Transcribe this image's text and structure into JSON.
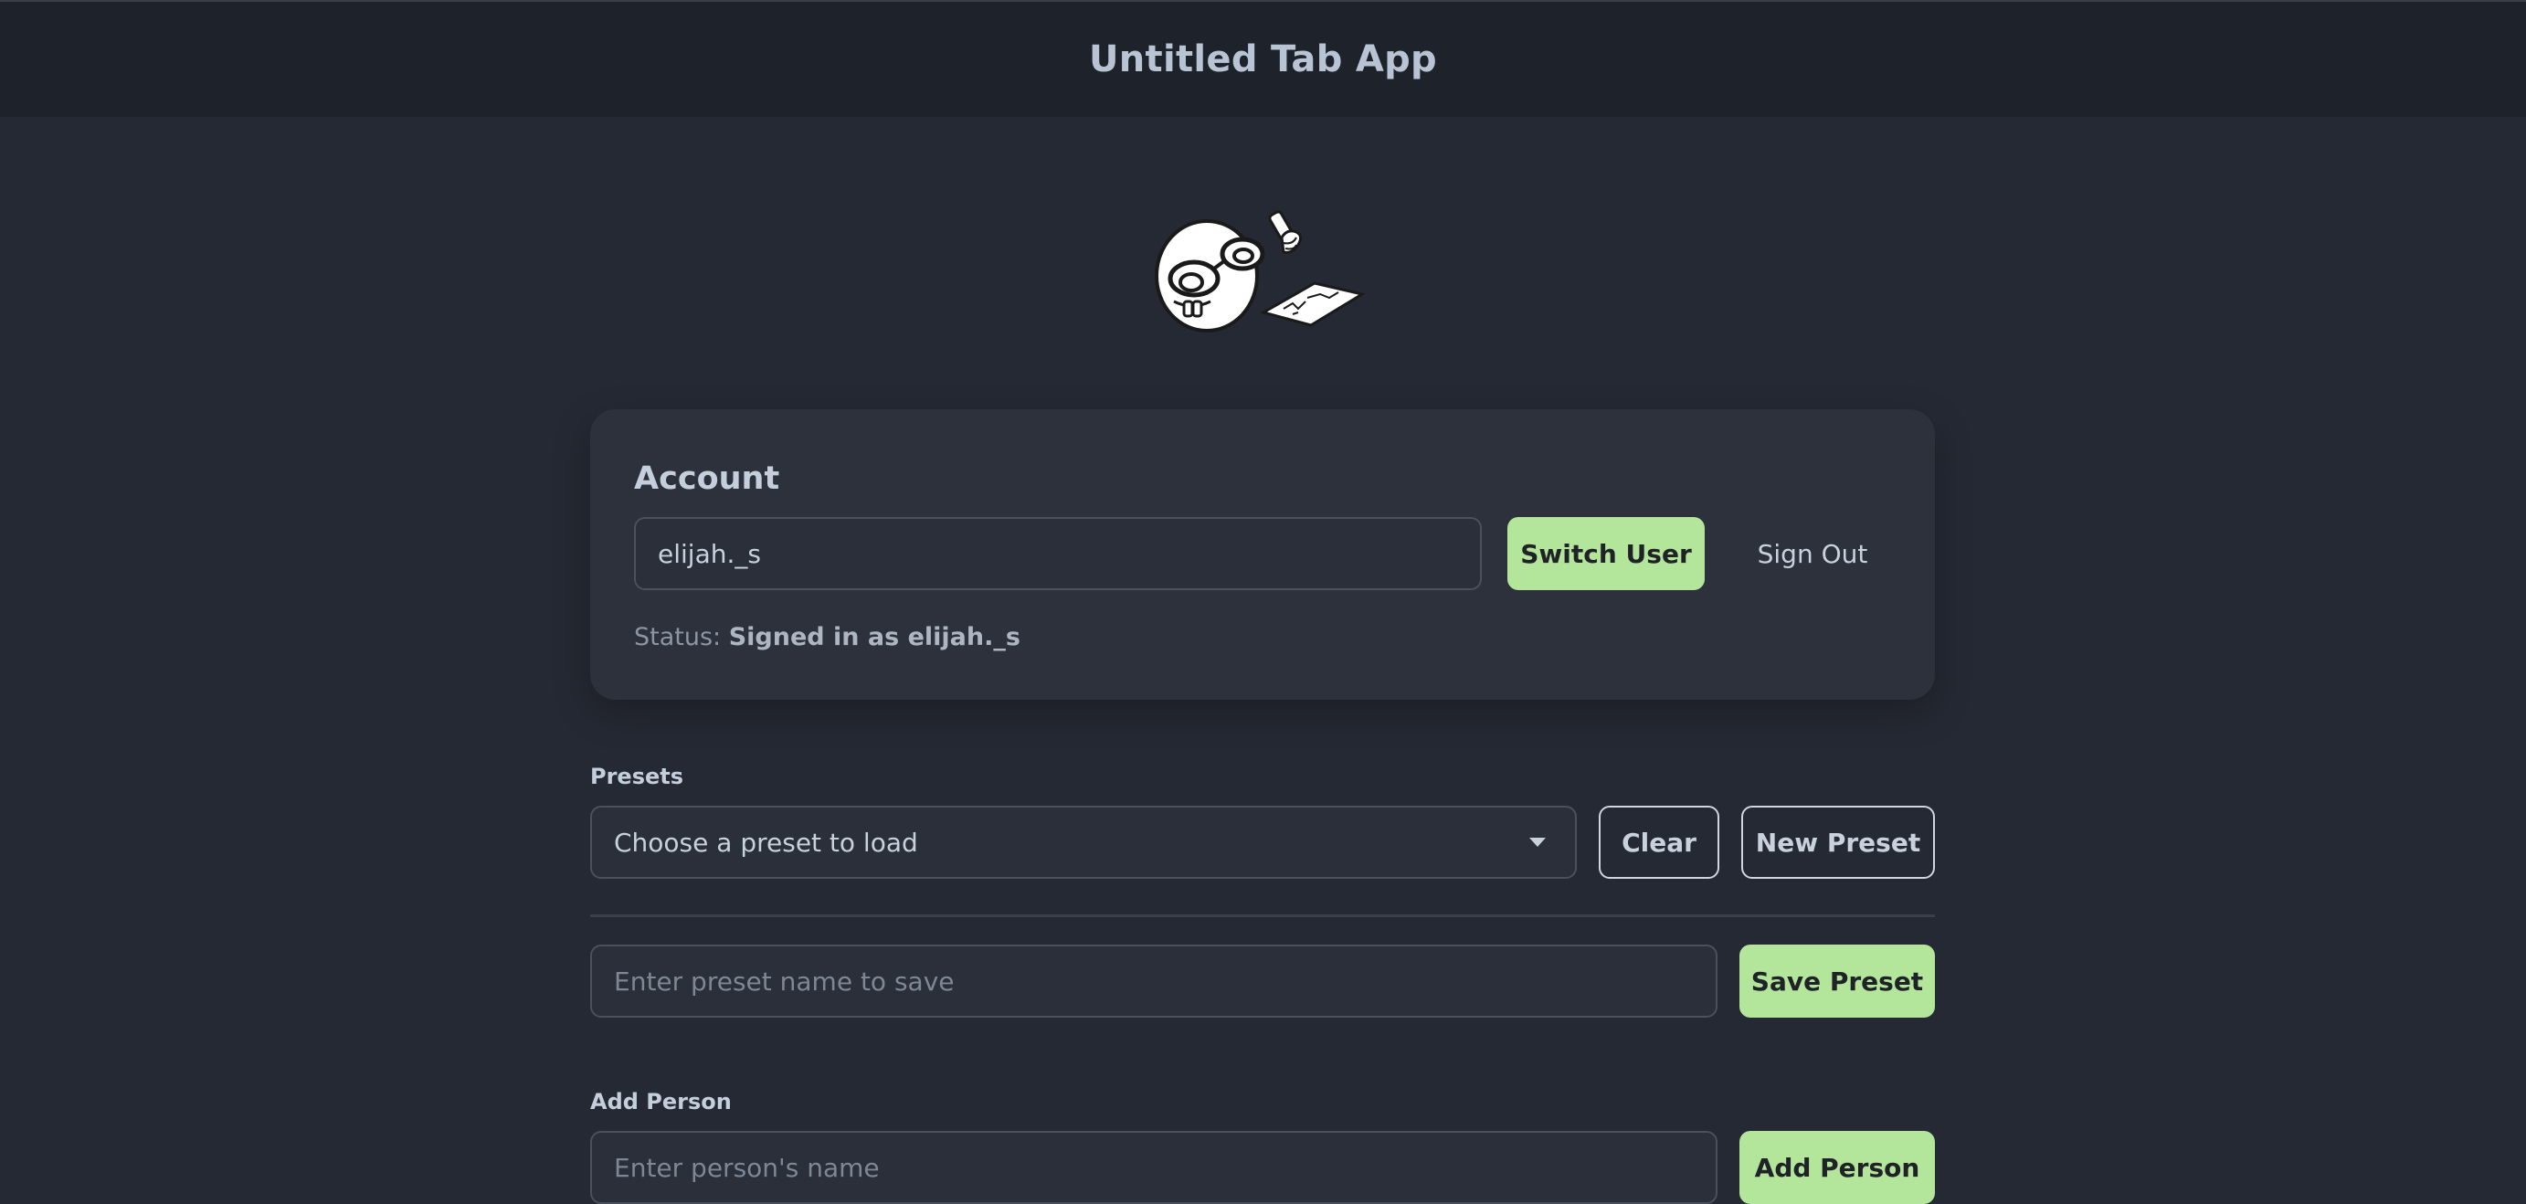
{
  "header": {
    "title": "Untitled Tab App"
  },
  "account": {
    "title": "Account",
    "username_value": "elijah._s",
    "switch_label": "Switch User",
    "signout_label": "Sign Out",
    "status_prefix": "Status:",
    "status_value": "Signed in as elijah._s"
  },
  "presets": {
    "label": "Presets",
    "select_placeholder": "Choose a preset to load",
    "clear_label": "Clear",
    "new_label": "New Preset",
    "name_placeholder": "Enter preset name to save",
    "save_label": "Save Preset"
  },
  "add_person": {
    "label": "Add Person",
    "placeholder": "Enter person's name",
    "button_label": "Add Person"
  },
  "colors": {
    "background": "#252933",
    "header_bg": "#1e222a",
    "card_bg": "#2c313c",
    "accent_green": "#b3e59a"
  },
  "icons": {
    "mascot": "nerd-mascot-illustration",
    "select_caret": "chevron-down-icon"
  }
}
